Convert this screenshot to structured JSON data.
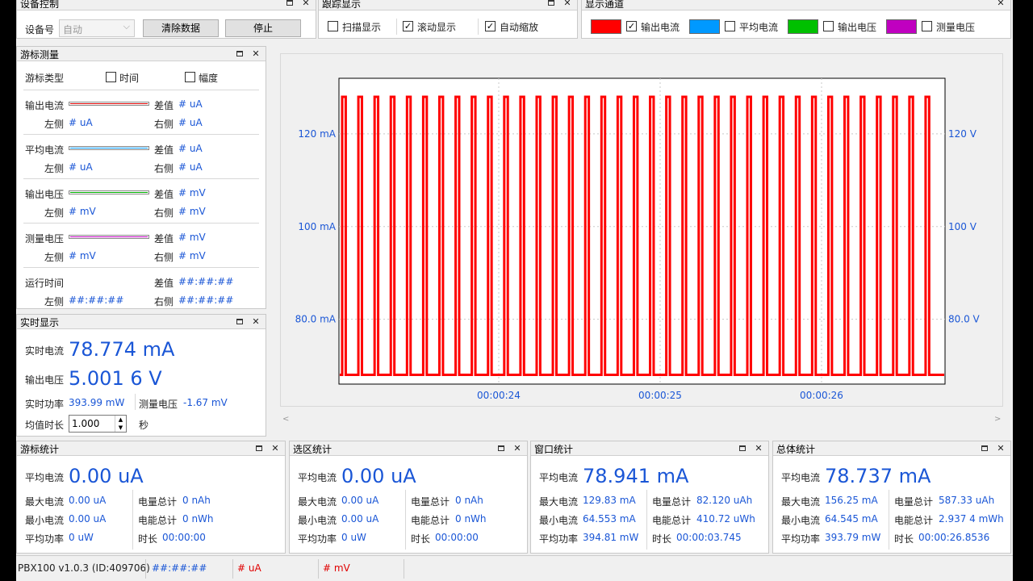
{
  "device": {
    "title": "设备控制",
    "device_label": "设备号",
    "device_value": "自动",
    "clear_button": "清除数据",
    "stop_button": "停止"
  },
  "trace": {
    "title": "跟踪显示",
    "scan": {
      "label": "扫描显示",
      "checked": false
    },
    "scroll": {
      "label": "滚动显示",
      "checked": true
    },
    "autozoom": {
      "label": "自动缩放",
      "checked": true
    }
  },
  "channels": {
    "title": "显示通道",
    "items": [
      {
        "label": "输出电流",
        "color": "#ff0000",
        "checked": true
      },
      {
        "label": "平均电流",
        "color": "#0099ff",
        "checked": false
      },
      {
        "label": "输出电压",
        "color": "#00c000",
        "checked": false
      },
      {
        "label": "测量电压",
        "color": "#c000c0",
        "checked": false
      }
    ]
  },
  "cursor": {
    "title": "游标测量",
    "type_label": "游标类型",
    "time_label": "时间",
    "amp_label": "幅度",
    "diff_label": "差值",
    "left_label": "左侧",
    "right_label": "右侧",
    "rows": [
      {
        "name": "输出电流",
        "color": "#e00000",
        "diff": "# uA",
        "left": "# uA",
        "right": "# uA"
      },
      {
        "name": "平均电流",
        "color": "#0099ff",
        "diff": "# uA",
        "left": "# uA",
        "right": "# uA"
      },
      {
        "name": "输出电压",
        "color": "#00b000",
        "diff": "# mV",
        "left": "# mV",
        "right": "# mV"
      },
      {
        "name": "测量电压",
        "color": "#c000c0",
        "diff": "# mV",
        "left": "# mV",
        "right": "# mV"
      }
    ],
    "runtime_label": "运行时间",
    "runtime_diff": "##:##:##",
    "runtime_left": "##:##:##",
    "runtime_right": "##:##:##"
  },
  "realtime": {
    "title": "实时显示",
    "current_label": "实时电流",
    "current_value": "78.774 mA",
    "voltage_label": "输出电压",
    "voltage_value": "5.001 6 V",
    "power_label": "实时功率",
    "power_value": "393.99 mW",
    "meas_label": "测量电压",
    "meas_value": "-1.67 mV",
    "avg_label": "均值时长",
    "avg_value": "1.000",
    "avg_unit": "秒"
  },
  "stats": [
    {
      "title": "游标统计",
      "avg": "0.00 uA",
      "max": "0.00 uA",
      "min": "0.00 uA",
      "power": "0 uW",
      "charge": "0 nAh",
      "energy": "0 nWh",
      "duration": "00:00:00"
    },
    {
      "title": "选区统计",
      "avg": "0.00 uA",
      "max": "0.00 uA",
      "min": "0.00 uA",
      "power": "0 uW",
      "charge": "0 nAh",
      "energy": "0 nWh",
      "duration": "00:00:00"
    },
    {
      "title": "窗口统计",
      "avg": "78.941 mA",
      "max": "129.83 mA",
      "min": "64.553 mA",
      "power": "394.81 mW",
      "charge": "82.120 uAh",
      "energy": "410.72 uWh",
      "duration": "00:00:03.745"
    },
    {
      "title": "总体统计",
      "avg": "78.737 mA",
      "max": "156.25 mA",
      "min": "64.545 mA",
      "power": "393.79 mW",
      "charge": "587.33 uAh",
      "energy": "2.937 4 mWh",
      "duration": "00:00:26.8536"
    }
  ],
  "stat_labels": {
    "avg": "平均电流",
    "max": "最大电流",
    "min": "最小电流",
    "power": "平均功率",
    "charge": "电量总计",
    "energy": "电能总计",
    "duration": "时长"
  },
  "chart_data": {
    "type": "line",
    "series": [
      {
        "name": "输出电流",
        "color": "#ff0000"
      }
    ],
    "y_left_ticks": [
      "120 mA",
      "100 mA",
      "80.0 mA"
    ],
    "y_right_ticks": [
      "120 V",
      "100 V",
      "80.0 V"
    ],
    "x_ticks": [
      "00:00:24",
      "00:00:25",
      "00:00:26"
    ],
    "ylim": [
      66,
      132
    ],
    "pulse_high": 128,
    "pulse_low": 68,
    "pulse_count": 37,
    "grid": true
  },
  "statusbar": {
    "version": "PBX100 v1.0.3 (ID:409706)",
    "time": "##:##:##",
    "current": "# uA",
    "voltage": "# mV"
  }
}
